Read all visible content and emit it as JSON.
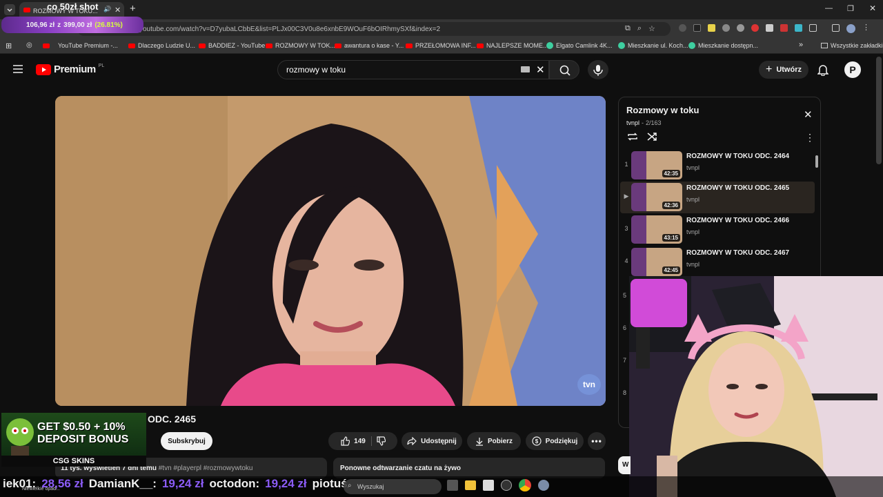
{
  "browser": {
    "tab_title": "ROZMOWY W TOKU...",
    "url": "youtube.com/watch?v=D7yubaLCbbE&list=PLJx00C3V0u8e6xnbE9WOuF6bOIRhmySXf&index=2",
    "bookmarks": [
      {
        "label": "YouTube Premium -..."
      },
      {
        "label": "Dlaczego Ludzie U..."
      },
      {
        "label": "BADDIEZ - YouTube"
      },
      {
        "label": "ROZMOWY W TOK..."
      },
      {
        "label": "awantura o kase - Y..."
      },
      {
        "label": "PRZEŁOMOWA INF..."
      },
      {
        "label": "NAJLEPSZE MOME..."
      },
      {
        "label": "Elgato Camlink 4K..."
      },
      {
        "label": "Mieszkanie ul. Koch..."
      },
      {
        "label": "Mieszkanie dostępn..."
      }
    ],
    "all_bookmarks_label": "Wszystkie zakładki"
  },
  "overlay": {
    "title": "co 50zł shot",
    "donation_current": "106,96 zł",
    "donation_sep": "z",
    "donation_goal": "399,00 zł",
    "donation_pct": "(26.81%)"
  },
  "youtube": {
    "logo": "Premium",
    "logo_region": "PL",
    "search_value": "rozmowy w toku",
    "create_label": "Utwórz",
    "avatar_letter": "P"
  },
  "video": {
    "title": "ODC. 2465",
    "watermark": "tvn",
    "subscribe_label": "Subskrybuj",
    "likes": "149",
    "share_label": "Udostępnij",
    "download_label": "Pobierz",
    "thanks_label": "Podziękuj",
    "views": "11 tys. wyświetleń",
    "age": "7 dni temu",
    "tags": "#tvn #playerpl #rozmowywtoku",
    "chat_replay": "Ponowne odtwarzanie czatu na żywo"
  },
  "playlist": {
    "title": "Rozmowy w toku",
    "channel": "tvnpl",
    "position": "2/163",
    "items": [
      {
        "num": "1",
        "title": "ROZMOWY W TOKU ODC. 2464",
        "channel": "tvnpl",
        "duration": "42:35"
      },
      {
        "num": "▶",
        "title": "ROZMOWY W TOKU ODC. 2465",
        "channel": "tvnpl",
        "duration": "42:36"
      },
      {
        "num": "3",
        "title": "ROZMOWY W TOKU ODC. 2466",
        "channel": "tvnpl",
        "duration": "43:15"
      },
      {
        "num": "4",
        "title": "ROZMOWY W TOKU ODC. 2467",
        "channel": "tvnpl",
        "duration": "42:45"
      }
    ],
    "hidden_nums": [
      "5",
      "6",
      "7",
      "8"
    ]
  },
  "ad": {
    "line1": "GET $0.50 + 10%",
    "line2": "DEPOSIT BONUS",
    "brand": "CSG SKINS"
  },
  "ticker": [
    {
      "name": "iek01:",
      "amount": "28,56 zł"
    },
    {
      "name": "DamianK__:",
      "amount": "19,24 zł"
    },
    {
      "name": "octodon:",
      "amount": "19,24 zł"
    },
    {
      "name": "piotuś",
      "amount": ""
    }
  ],
  "taskbar": {
    "search_placeholder": "Wyszukaj",
    "weather": "Niewielkie opad..."
  },
  "colors": {
    "accent_red": "#ff0000",
    "ticker_amount": "#8b5cf6",
    "donation_pct": "#d7ff3c"
  }
}
